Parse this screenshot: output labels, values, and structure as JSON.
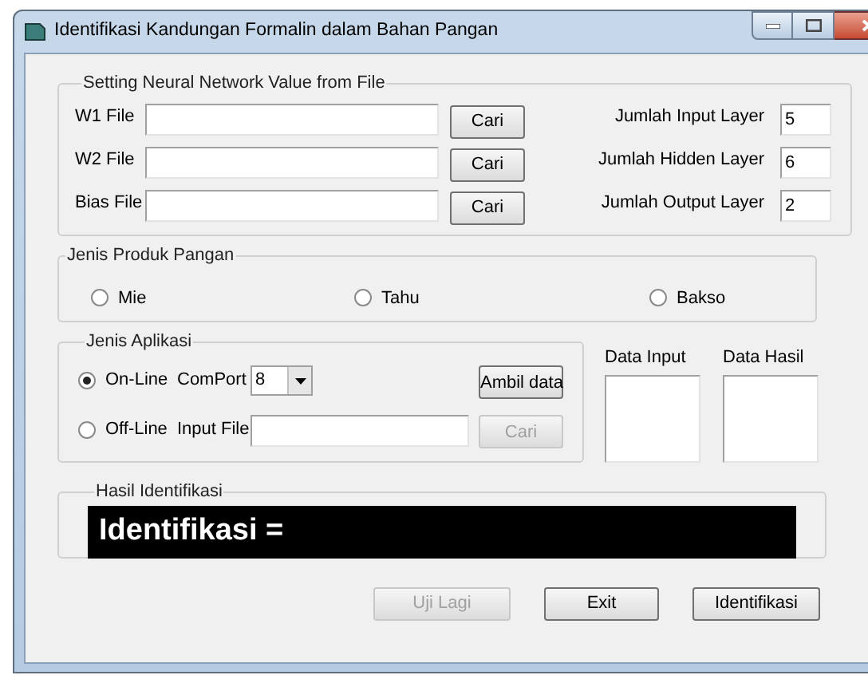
{
  "window": {
    "title": "Identifikasi Kandungan Formalin dalam Bahan Pangan"
  },
  "network_group": {
    "title": "Setting Neural Network Value from File",
    "files": [
      {
        "label": "W1 File",
        "button": "Cari"
      },
      {
        "label": "W2 File",
        "button": "Cari"
      },
      {
        "label": "Bias File",
        "button": "Cari"
      }
    ],
    "layers": [
      {
        "label": "Jumlah Input Layer",
        "value": "5"
      },
      {
        "label": "Jumlah Hidden Layer",
        "value": "6"
      },
      {
        "label": "Jumlah Output Layer",
        "value": "2"
      }
    ]
  },
  "product_group": {
    "title": "Jenis Produk Pangan",
    "options": [
      {
        "label": "Mie",
        "selected": false
      },
      {
        "label": "Tahu",
        "selected": false
      },
      {
        "label": "Bakso",
        "selected": false
      }
    ]
  },
  "application_group": {
    "title": "Jenis Aplikasi",
    "online": {
      "label": "On-Line",
      "selected": true,
      "field_label": "ComPort",
      "value": "8",
      "button": {
        "label": "Ambil data",
        "disabled": false
      }
    },
    "offline": {
      "label": "Off-Line",
      "selected": false,
      "field_label": "Input File",
      "button": {
        "label": "Cari",
        "disabled": true
      }
    }
  },
  "data_lists": [
    {
      "label": "Data Input"
    },
    {
      "label": "Data Hasil"
    }
  ],
  "result_group": {
    "title": "Hasil Identifikasi",
    "text": "Identifikasi ="
  },
  "buttons": [
    {
      "label": "Uji Lagi",
      "disabled": true
    },
    {
      "label": "Exit",
      "disabled": false
    },
    {
      "label": "Identifikasi",
      "disabled": false
    }
  ]
}
